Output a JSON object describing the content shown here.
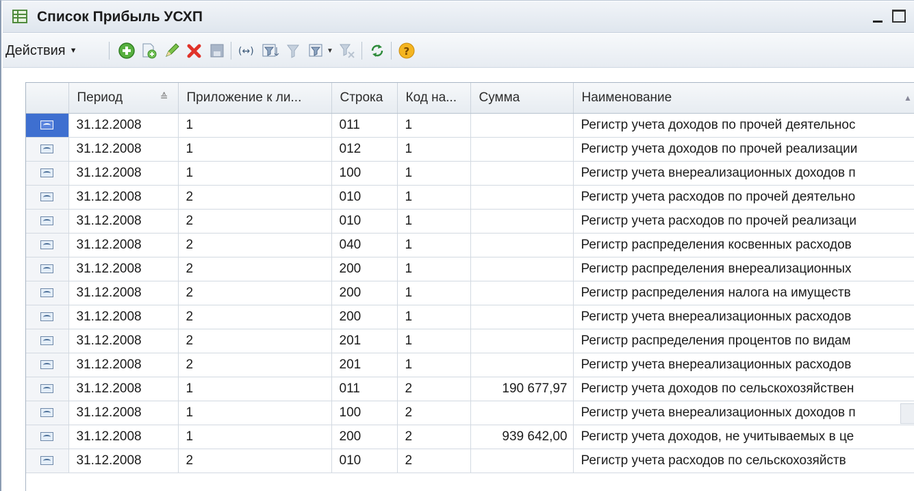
{
  "window": {
    "title": "Список Прибыль УСХП"
  },
  "toolbar": {
    "actions_label": "Действия",
    "buttons": [
      {
        "icon": "add-icon"
      },
      {
        "icon": "copy-icon"
      },
      {
        "icon": "edit-icon"
      },
      {
        "icon": "delete-icon"
      },
      {
        "icon": "post-icon"
      },
      {
        "icon": "interval-icon"
      },
      {
        "icon": "filter-settings-icon"
      },
      {
        "icon": "filter-by-value-icon"
      },
      {
        "icon": "filter-history-icon"
      },
      {
        "icon": "filter-clear-icon"
      },
      {
        "icon": "refresh-icon"
      },
      {
        "icon": "help-icon"
      }
    ]
  },
  "table": {
    "columns": [
      "",
      "Период",
      "Приложение к ли...",
      "Строка",
      "Код на...",
      "Сумма",
      "Наименование"
    ],
    "rows": [
      {
        "period": "31.12.2008",
        "app": "1",
        "line": "011",
        "code": "1",
        "sum": "",
        "name": "Регистр учета доходов по прочей деятельнос"
      },
      {
        "period": "31.12.2008",
        "app": "1",
        "line": "012",
        "code": "1",
        "sum": "",
        "name": "Регистр учета доходов по прочей реализации"
      },
      {
        "period": "31.12.2008",
        "app": "1",
        "line": "100",
        "code": "1",
        "sum": "",
        "name": "Регистр учета внереализационных доходов п"
      },
      {
        "period": "31.12.2008",
        "app": "2",
        "line": "010",
        "code": "1",
        "sum": "",
        "name": "Регистр учета расходов по прочей деятельно"
      },
      {
        "period": "31.12.2008",
        "app": "2",
        "line": "010",
        "code": "1",
        "sum": "",
        "name": "Регистр учета расходов по прочей реализаци"
      },
      {
        "period": "31.12.2008",
        "app": "2",
        "line": "040",
        "code": "1",
        "sum": "",
        "name": "Регистр распределения косвенных расходов"
      },
      {
        "period": "31.12.2008",
        "app": "2",
        "line": "200",
        "code": "1",
        "sum": "",
        "name": "Регистр распределения внереализационных"
      },
      {
        "period": "31.12.2008",
        "app": "2",
        "line": "200",
        "code": "1",
        "sum": "",
        "name": "Регистр распределения налога на имуществ"
      },
      {
        "period": "31.12.2008",
        "app": "2",
        "line": "200",
        "code": "1",
        "sum": "",
        "name": "Регистр учета внереализационных расходов"
      },
      {
        "period": "31.12.2008",
        "app": "2",
        "line": "201",
        "code": "1",
        "sum": "",
        "name": "Регистр распределения процентов по видам"
      },
      {
        "period": "31.12.2008",
        "app": "2",
        "line": "201",
        "code": "1",
        "sum": "",
        "name": "Регистр учета внереализационных расходов"
      },
      {
        "period": "31.12.2008",
        "app": "1",
        "line": "011",
        "code": "2",
        "sum": "190 677,97",
        "name": "Регистр учета доходов по сельскохозяйствен"
      },
      {
        "period": "31.12.2008",
        "app": "1",
        "line": "100",
        "code": "2",
        "sum": "",
        "name": "Регистр учета внереализационных доходов п"
      },
      {
        "period": "31.12.2008",
        "app": "1",
        "line": "200",
        "code": "2",
        "sum": "939 642,00",
        "name": "Регистр учета доходов, не учитываемых в це"
      },
      {
        "period": "31.12.2008",
        "app": "2",
        "line": "010",
        "code": "2",
        "sum": "",
        "name": "Регистр учета расходов по сельскохозяйств"
      }
    ],
    "selected_row": 0
  }
}
